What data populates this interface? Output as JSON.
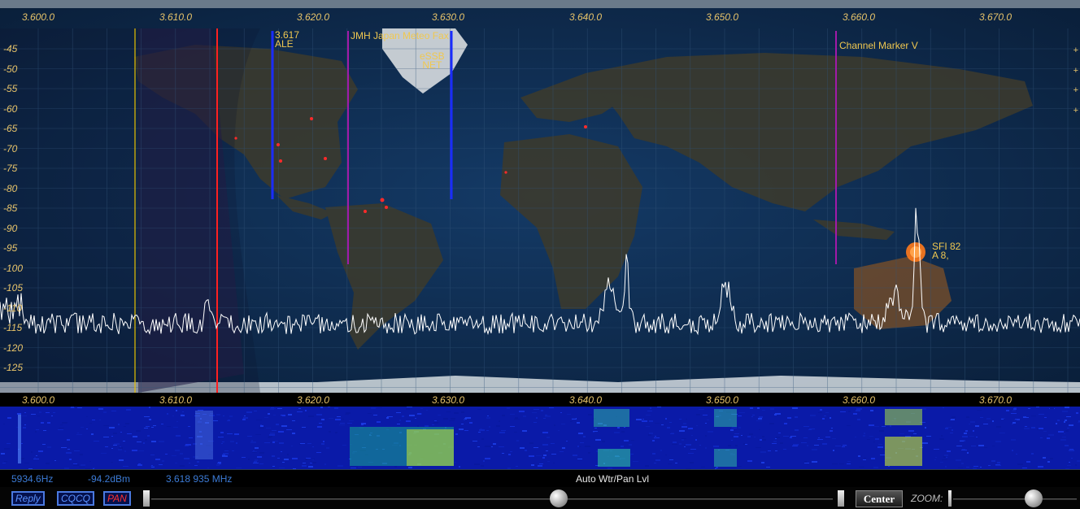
{
  "spectrum": {
    "freq_labels": [
      "3.600.0",
      "3.610.0",
      "3.620.0",
      "3.630.0",
      "3.640.0",
      "3.650.0",
      "3.660.0",
      "3.670.0"
    ],
    "db_labels": [
      "-45",
      "-50",
      "-55",
      "-60",
      "-65",
      "-70",
      "-75",
      "-80",
      "-85",
      "-90",
      "-95",
      "-100",
      "-105",
      "-110",
      "-115",
      "-120",
      "-125"
    ],
    "right_plus_labels": [
      "+",
      "+",
      "+",
      "+"
    ],
    "markers": {
      "ale_freq": "3.617",
      "ale_name": "ALE",
      "jmh": "JMH Japan Meteo Fax",
      "essb_1": "eSSB",
      "essb_2": "NET",
      "channel_marker": "Channel Marker V"
    },
    "solar": {
      "sfi": "SFI 82",
      "a_index": "A 8,"
    },
    "colors": {
      "label": "#e8c46a",
      "trace": "#ffffff",
      "marker_blue": "#1a2cff",
      "marker_magenta": "#a21aa8",
      "marker_red": "#ff2020",
      "marker_yellow": "#e8c000"
    }
  },
  "waterfall": {
    "freq_labels": [
      "3.600.0",
      "3.610.0",
      "3.620.0",
      "3.630.0",
      "3.640.0",
      "3.650.0",
      "3.660.0",
      "3.670.0"
    ]
  },
  "status": {
    "offset": "5934.6Hz",
    "level": "-94.2dBm",
    "frequency": "3.618 935 MHz",
    "auto_level": "Auto Wtr/Pan Lvl"
  },
  "controls": {
    "reply": "Reply",
    "cqcq": "CQCQ",
    "pan": "PAN",
    "center": "Center",
    "zoom": "ZOOM:"
  }
}
